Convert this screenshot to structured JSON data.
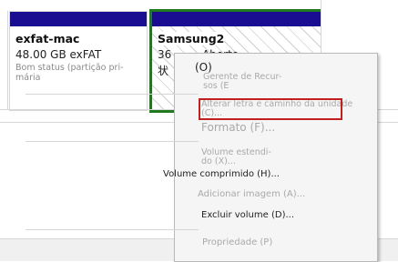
{
  "partitions": [
    {
      "name": "exfat-mac",
      "size_fs": "48.00 GB exFAT",
      "status": "Bom status (partição pri-\nmária"
    },
    {
      "name": "Samsung2",
      "size_fs": "36",
      "size_fs_tail": "Aberto",
      "extra_glyph": "状"
    }
  ],
  "context_menu": {
    "open_label": "(O)",
    "items": [
      {
        "label": "Gerente de Recur-\nsos (E",
        "enabled": false
      },
      {
        "label": "Alterar letra e caminho da unidade\n(C)...",
        "enabled": false,
        "highlighted": true
      },
      {
        "label": "Formato (F)...",
        "enabled": false
      },
      {
        "label": "Volume estendi-\ndo (X)...",
        "enabled": false
      },
      {
        "label": "Volume comprimido (H)...",
        "enabled": true
      },
      {
        "label": "Adicionar imagem (A)...",
        "enabled": false
      },
      {
        "label": "Excluir volume (D)...",
        "enabled": true
      },
      {
        "label": "Propriedade (P)",
        "enabled": false
      }
    ]
  },
  "colors": {
    "primary_bar": "#1a0d91",
    "selected_border": "#1f7a1f",
    "highlight_border": "#c02020"
  }
}
